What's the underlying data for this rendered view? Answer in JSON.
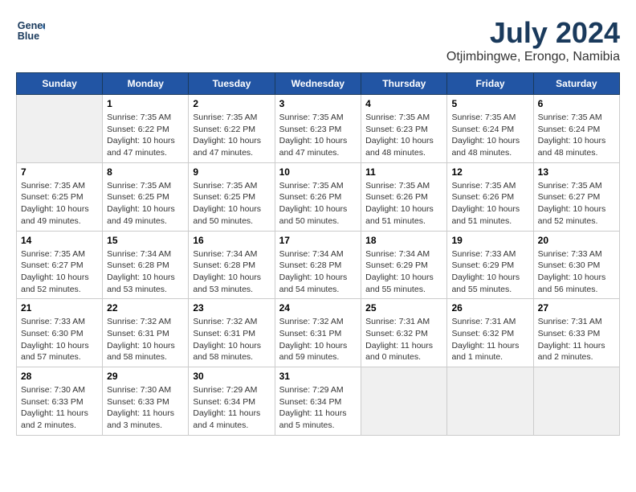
{
  "header": {
    "logo_line1": "General",
    "logo_line2": "Blue",
    "month_title": "July 2024",
    "location": "Otjimbingwe, Erongo, Namibia"
  },
  "days_of_week": [
    "Sunday",
    "Monday",
    "Tuesday",
    "Wednesday",
    "Thursday",
    "Friday",
    "Saturday"
  ],
  "weeks": [
    [
      {
        "day": "",
        "info": ""
      },
      {
        "day": "1",
        "info": "Sunrise: 7:35 AM\nSunset: 6:22 PM\nDaylight: 10 hours and 47 minutes."
      },
      {
        "day": "2",
        "info": "Sunrise: 7:35 AM\nSunset: 6:22 PM\nDaylight: 10 hours and 47 minutes."
      },
      {
        "day": "3",
        "info": "Sunrise: 7:35 AM\nSunset: 6:23 PM\nDaylight: 10 hours and 47 minutes."
      },
      {
        "day": "4",
        "info": "Sunrise: 7:35 AM\nSunset: 6:23 PM\nDaylight: 10 hours and 48 minutes."
      },
      {
        "day": "5",
        "info": "Sunrise: 7:35 AM\nSunset: 6:24 PM\nDaylight: 10 hours and 48 minutes."
      },
      {
        "day": "6",
        "info": "Sunrise: 7:35 AM\nSunset: 6:24 PM\nDaylight: 10 hours and 48 minutes."
      }
    ],
    [
      {
        "day": "7",
        "info": "Sunrise: 7:35 AM\nSunset: 6:25 PM\nDaylight: 10 hours and 49 minutes."
      },
      {
        "day": "8",
        "info": "Sunrise: 7:35 AM\nSunset: 6:25 PM\nDaylight: 10 hours and 49 minutes."
      },
      {
        "day": "9",
        "info": "Sunrise: 7:35 AM\nSunset: 6:25 PM\nDaylight: 10 hours and 50 minutes."
      },
      {
        "day": "10",
        "info": "Sunrise: 7:35 AM\nSunset: 6:26 PM\nDaylight: 10 hours and 50 minutes."
      },
      {
        "day": "11",
        "info": "Sunrise: 7:35 AM\nSunset: 6:26 PM\nDaylight: 10 hours and 51 minutes."
      },
      {
        "day": "12",
        "info": "Sunrise: 7:35 AM\nSunset: 6:26 PM\nDaylight: 10 hours and 51 minutes."
      },
      {
        "day": "13",
        "info": "Sunrise: 7:35 AM\nSunset: 6:27 PM\nDaylight: 10 hours and 52 minutes."
      }
    ],
    [
      {
        "day": "14",
        "info": "Sunrise: 7:35 AM\nSunset: 6:27 PM\nDaylight: 10 hours and 52 minutes."
      },
      {
        "day": "15",
        "info": "Sunrise: 7:34 AM\nSunset: 6:28 PM\nDaylight: 10 hours and 53 minutes."
      },
      {
        "day": "16",
        "info": "Sunrise: 7:34 AM\nSunset: 6:28 PM\nDaylight: 10 hours and 53 minutes."
      },
      {
        "day": "17",
        "info": "Sunrise: 7:34 AM\nSunset: 6:28 PM\nDaylight: 10 hours and 54 minutes."
      },
      {
        "day": "18",
        "info": "Sunrise: 7:34 AM\nSunset: 6:29 PM\nDaylight: 10 hours and 55 minutes."
      },
      {
        "day": "19",
        "info": "Sunrise: 7:33 AM\nSunset: 6:29 PM\nDaylight: 10 hours and 55 minutes."
      },
      {
        "day": "20",
        "info": "Sunrise: 7:33 AM\nSunset: 6:30 PM\nDaylight: 10 hours and 56 minutes."
      }
    ],
    [
      {
        "day": "21",
        "info": "Sunrise: 7:33 AM\nSunset: 6:30 PM\nDaylight: 10 hours and 57 minutes."
      },
      {
        "day": "22",
        "info": "Sunrise: 7:32 AM\nSunset: 6:31 PM\nDaylight: 10 hours and 58 minutes."
      },
      {
        "day": "23",
        "info": "Sunrise: 7:32 AM\nSunset: 6:31 PM\nDaylight: 10 hours and 58 minutes."
      },
      {
        "day": "24",
        "info": "Sunrise: 7:32 AM\nSunset: 6:31 PM\nDaylight: 10 hours and 59 minutes."
      },
      {
        "day": "25",
        "info": "Sunrise: 7:31 AM\nSunset: 6:32 PM\nDaylight: 11 hours and 0 minutes."
      },
      {
        "day": "26",
        "info": "Sunrise: 7:31 AM\nSunset: 6:32 PM\nDaylight: 11 hours and 1 minute."
      },
      {
        "day": "27",
        "info": "Sunrise: 7:31 AM\nSunset: 6:33 PM\nDaylight: 11 hours and 2 minutes."
      }
    ],
    [
      {
        "day": "28",
        "info": "Sunrise: 7:30 AM\nSunset: 6:33 PM\nDaylight: 11 hours and 2 minutes."
      },
      {
        "day": "29",
        "info": "Sunrise: 7:30 AM\nSunset: 6:33 PM\nDaylight: 11 hours and 3 minutes."
      },
      {
        "day": "30",
        "info": "Sunrise: 7:29 AM\nSunset: 6:34 PM\nDaylight: 11 hours and 4 minutes."
      },
      {
        "day": "31",
        "info": "Sunrise: 7:29 AM\nSunset: 6:34 PM\nDaylight: 11 hours and 5 minutes."
      },
      {
        "day": "",
        "info": ""
      },
      {
        "day": "",
        "info": ""
      },
      {
        "day": "",
        "info": ""
      }
    ]
  ]
}
